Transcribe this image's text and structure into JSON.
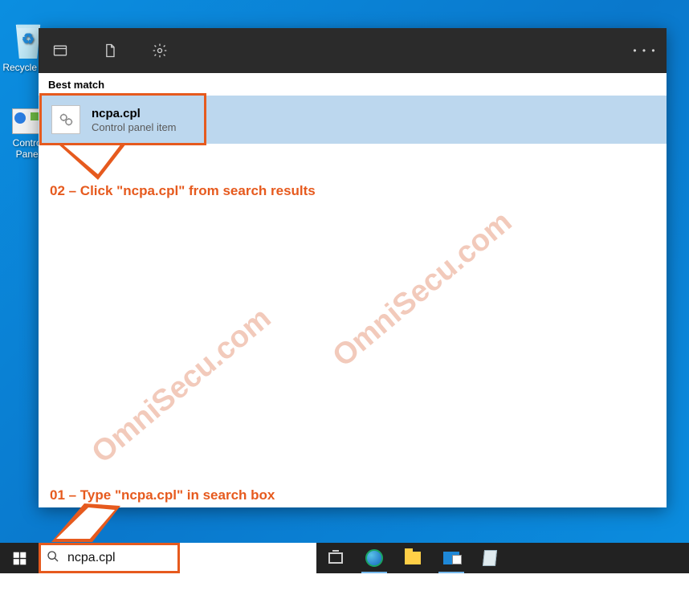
{
  "desktop": {
    "recycle_bin_label": "Recycle Bin",
    "control_panel_label": "Control Panel"
  },
  "search_panel": {
    "best_match_label": "Best match",
    "result": {
      "title": "ncpa.cpl",
      "subtitle": "Control panel item"
    },
    "more_label": "• • •"
  },
  "annotations": {
    "step02": "02 – Click \"ncpa.cpl\" from search results",
    "step01": "01 – Type \"ncpa.cpl\" in search box"
  },
  "watermark": "OmniSecu.com",
  "taskbar": {
    "search_value": "ncpa.cpl"
  },
  "colors": {
    "highlight": "#e65a1e",
    "selection": "#bcd7ee"
  }
}
